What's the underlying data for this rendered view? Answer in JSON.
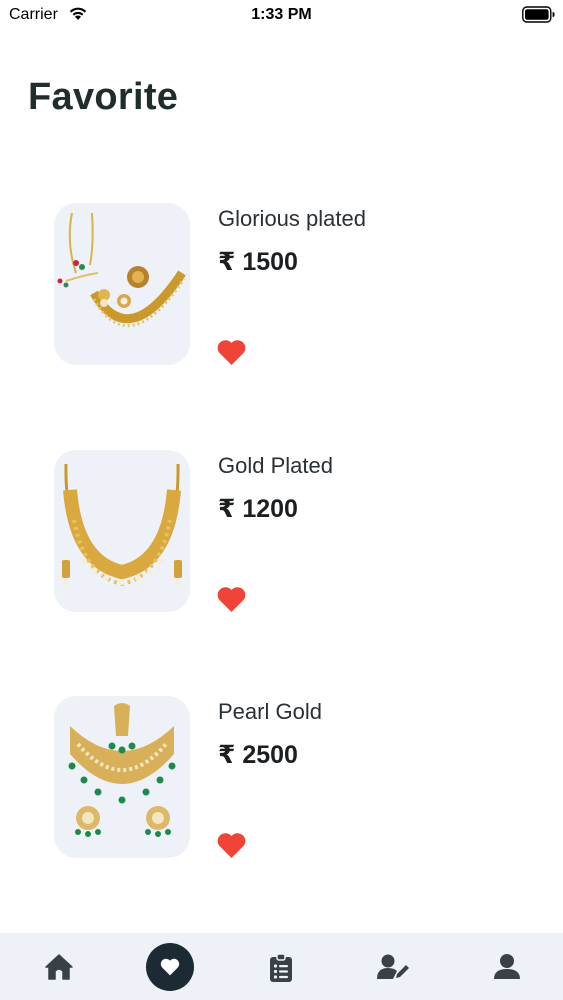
{
  "status_bar": {
    "carrier": "Carrier",
    "time": "1:33 PM"
  },
  "page": {
    "title": "Favorite"
  },
  "favorites": [
    {
      "name": "Glorious plated",
      "price": "₹ 1500",
      "image": "gold-necklace-earrings-set",
      "favorited": true
    },
    {
      "name": "Gold Plated",
      "price": "₹ 1200",
      "image": "gold-choker-necklace",
      "favorited": true
    },
    {
      "name": "Pearl Gold",
      "price": "₹ 2500",
      "image": "kundan-pearl-necklace-set",
      "favorited": true
    }
  ],
  "bottom_nav": {
    "items": [
      {
        "icon": "home-icon",
        "active": false
      },
      {
        "icon": "heart-icon",
        "active": true
      },
      {
        "icon": "clipboard-list-icon",
        "active": false
      },
      {
        "icon": "user-edit-icon",
        "active": false
      },
      {
        "icon": "user-icon",
        "active": false
      }
    ]
  },
  "colors": {
    "heart": "#f04438",
    "nav_background": "#eef1f8",
    "nav_active": "#1c2b33",
    "nav_icon": "#3a4146",
    "thumb_background": "#eef1f7"
  }
}
